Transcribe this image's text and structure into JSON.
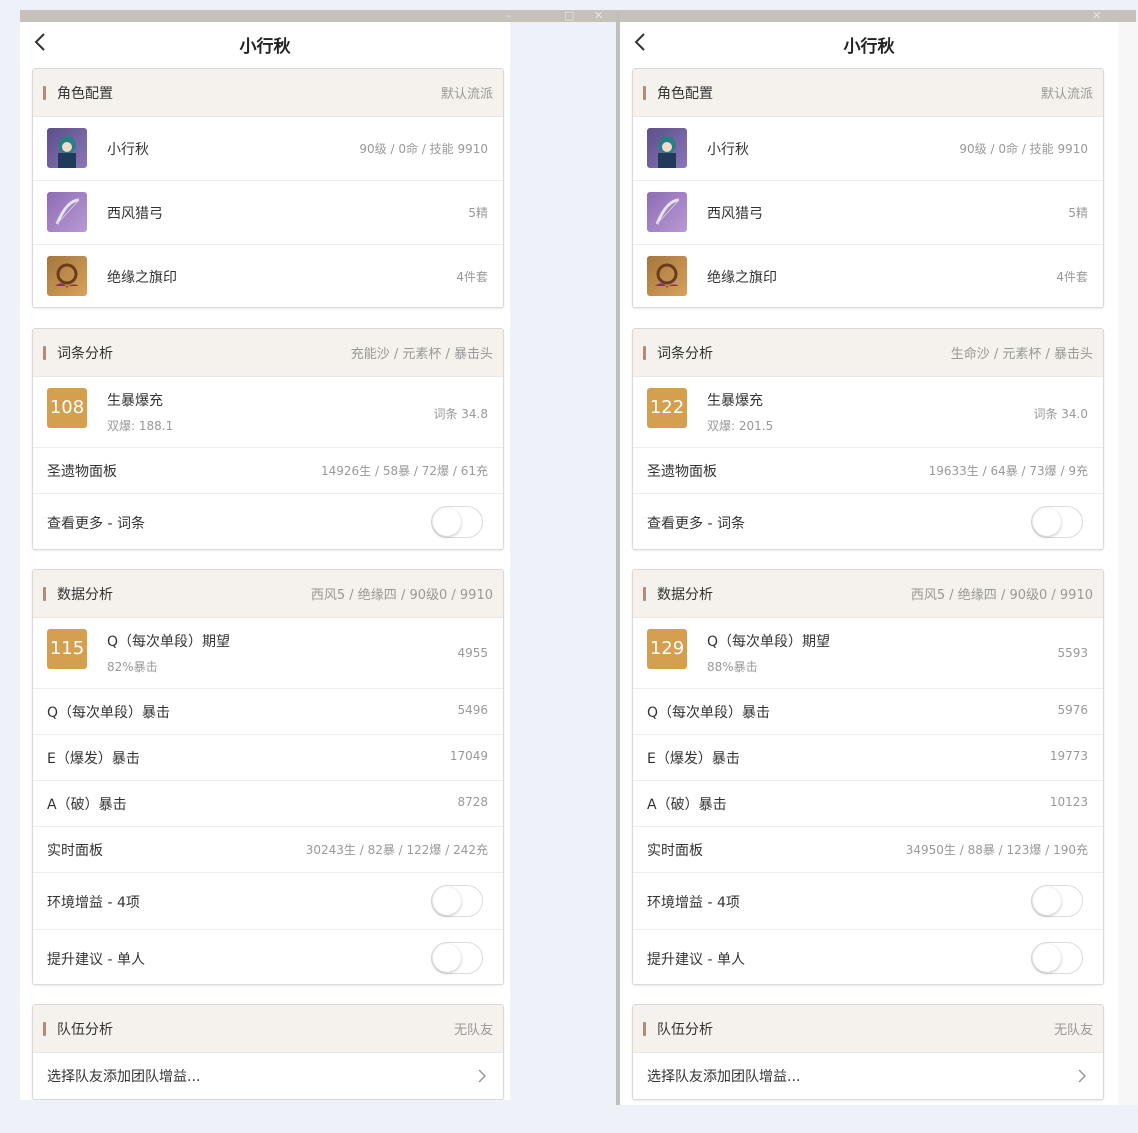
{
  "window": {
    "min_icon": "minimize-icon",
    "max_icon": "maximize-icon",
    "close_icon": "close-icon"
  },
  "panels": [
    {
      "title": "小行秋",
      "config": {
        "title": "角色配置",
        "right": "默认流派",
        "character": {
          "name": "小行秋",
          "info": "90级 / 0命 / 技能 9910"
        },
        "weapon": {
          "name": "西风猎弓",
          "info": "5精"
        },
        "artifact": {
          "name": "绝缘之旗印",
          "info": "4件套"
        }
      },
      "stats": {
        "title": "词条分析",
        "right": "充能沙 / 元素杯 / 暴击头",
        "score": "108",
        "score_title": "生暴爆充",
        "score_sub": "双爆: 188.1",
        "score_value": "词条 34.8",
        "artifact_panel_label": "圣遗物面板",
        "artifact_panel_value": "14926生 / 58暴 / 72爆 / 61充",
        "more_label": "查看更多 - 词条"
      },
      "damage": {
        "title": "数据分析",
        "right": "西风5 / 绝缘四 / 90级0 / 9910",
        "score": "115",
        "score_title": "Q（每次单段）期望",
        "score_sub": "82%暴击",
        "score_value": "4955",
        "rows": [
          {
            "label": "Q（每次单段）暴击",
            "value": "5496"
          },
          {
            "label": "E（爆发）暴击",
            "value": "17049"
          },
          {
            "label": "A（破）暴击",
            "value": "8728"
          },
          {
            "label": "实时面板",
            "value": "30243生 / 82暴 / 122爆 / 242充"
          }
        ],
        "env_label": "环境增益 - 4项",
        "advice_label": "提升建议 - 单人"
      },
      "team": {
        "title": "队伍分析",
        "right": "无队友",
        "select_label": "选择队友添加团队增益..."
      }
    },
    {
      "title": "小行秋",
      "config": {
        "title": "角色配置",
        "right": "默认流派",
        "character": {
          "name": "小行秋",
          "info": "90级 / 0命 / 技能 9910"
        },
        "weapon": {
          "name": "西风猎弓",
          "info": "5精"
        },
        "artifact": {
          "name": "绝缘之旗印",
          "info": "4件套"
        }
      },
      "stats": {
        "title": "词条分析",
        "right": "生命沙 / 元素杯 / 暴击头",
        "score": "122",
        "score_title": "生暴爆充",
        "score_sub": "双爆: 201.5",
        "score_value": "词条 34.0",
        "artifact_panel_label": "圣遗物面板",
        "artifact_panel_value": "19633生 / 64暴 / 73爆 / 9充",
        "more_label": "查看更多 - 词条"
      },
      "damage": {
        "title": "数据分析",
        "right": "西风5 / 绝缘四 / 90级0 / 9910",
        "score": "129",
        "score_title": "Q（每次单段）期望",
        "score_sub": "88%暴击",
        "score_value": "5593",
        "rows": [
          {
            "label": "Q（每次单段）暴击",
            "value": "5976"
          },
          {
            "label": "E（爆发）暴击",
            "value": "19773"
          },
          {
            "label": "A（破）暴击",
            "value": "10123"
          },
          {
            "label": "实时面板",
            "value": "34950生 / 88暴 / 123爆 / 190充"
          }
        ],
        "env_label": "环境增益 - 4项",
        "advice_label": "提升建议 - 单人"
      },
      "team": {
        "title": "队伍分析",
        "right": "无队友",
        "select_label": "选择队友添加团队增益..."
      }
    }
  ]
}
